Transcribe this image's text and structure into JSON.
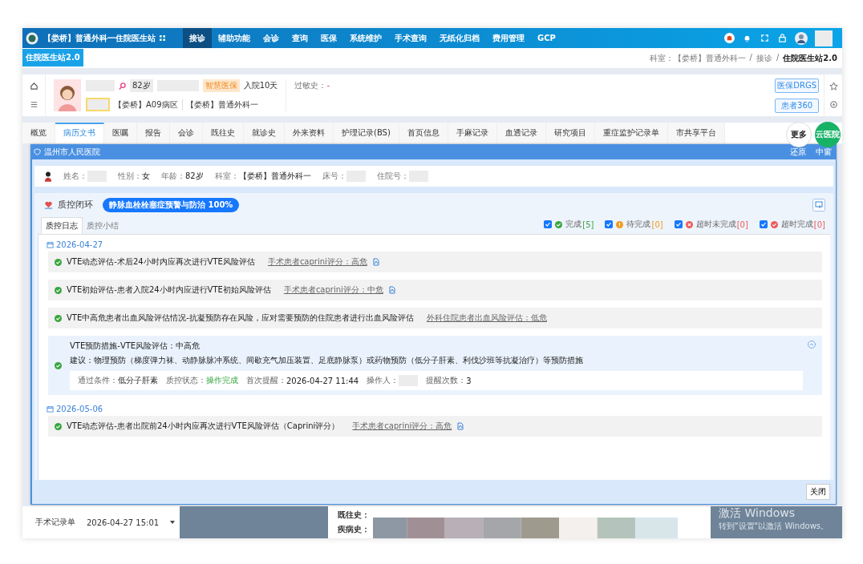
{
  "top_nav": {
    "title": "【娄桥】普通外科一住院医生站",
    "menu": [
      {
        "label": "接诊",
        "selected": true
      },
      {
        "label": "辅助功能",
        "selected": false
      },
      {
        "label": "会诊",
        "selected": false
      },
      {
        "label": "查询",
        "selected": false
      },
      {
        "label": "医保",
        "selected": false
      },
      {
        "label": "系统维护",
        "selected": false
      },
      {
        "label": "手术查询",
        "selected": false
      },
      {
        "label": "无纸化归档",
        "selected": false
      },
      {
        "label": "费用管理",
        "selected": false
      },
      {
        "label": "GCP",
        "selected": false
      }
    ]
  },
  "app_tab": "住院医生站2.0",
  "breadcrumb": [
    "科室：【娄桥】普通外科一",
    "接诊",
    "住院医生站2.0"
  ],
  "breadcrumb_separator": "/",
  "patient": {
    "age": "82岁",
    "insurance_tag": "智慧医保",
    "admission": "入院10天",
    "ward": "【娄桥】A09病区",
    "dept": "【娄桥】普通外科一",
    "allergy_label": "过敏史：",
    "allergy_value": "-",
    "buttons": [
      "医保DRGS",
      "患者360"
    ]
  },
  "record_tabs": [
    {
      "label": "概览",
      "selected": false
    },
    {
      "label": "病历文书",
      "selected": true
    },
    {
      "label": "医嘱",
      "selected": false
    },
    {
      "label": "报告",
      "selected": false
    },
    {
      "label": "会诊",
      "selected": false
    },
    {
      "label": "既往史",
      "selected": false
    },
    {
      "label": "就诊史",
      "selected": false
    },
    {
      "label": "外来资料",
      "selected": false
    },
    {
      "label": "护理记录(BS)",
      "selected": false
    },
    {
      "label": "首页信息",
      "selected": false
    },
    {
      "label": "手麻记录",
      "selected": false
    },
    {
      "label": "血透记录",
      "selected": false
    },
    {
      "label": "研究项目",
      "selected": false
    },
    {
      "label": "重症监护记录单",
      "selected": false
    },
    {
      "label": "市共享平台",
      "selected": false
    }
  ],
  "more_button": "更多",
  "cloud_button": "云医院",
  "modal": {
    "title": "温州市人民医院",
    "actions": [
      "还原",
      "中窗"
    ],
    "patient_fields": [
      {
        "label": "姓名："
      },
      {
        "label": "性别：",
        "value": "女"
      },
      {
        "label": "年龄：",
        "value": "82岁"
      },
      {
        "label": "科室：",
        "value": "【娄桥】普通外科一"
      },
      {
        "label": "床号："
      },
      {
        "label": "住院号："
      }
    ],
    "qc_title": "质控闭环",
    "qc_pill": "静脉血栓栓塞症预警与防治 100%",
    "subtabs": [
      {
        "label": "质控日志",
        "selected": true
      },
      {
        "label": "质控小结",
        "selected": false
      }
    ],
    "filters": [
      {
        "kind": "done",
        "label": "完成",
        "count": "[5]",
        "checked": true
      },
      {
        "kind": "pending",
        "label": "待完成",
        "count": "[0]",
        "checked": true
      },
      {
        "kind": "overdue",
        "label": "超时未完成",
        "count": "[0]",
        "checked": true
      },
      {
        "kind": "late",
        "label": "超时完成",
        "count": "[0]",
        "checked": true
      }
    ],
    "groups": [
      {
        "date": "2026-04-27",
        "entries": [
          {
            "kind": "simple",
            "text": "VTE动态评估-术后24小时内应再次进行VTE风险评估",
            "link": "手术患者caprini评分：高危",
            "report_icon": true
          },
          {
            "kind": "simple",
            "text": "VTE初始评估-患者入院24小时内应进行VTE初始风险评估",
            "link": "手术患者caprini评分：中危",
            "report_icon": true
          },
          {
            "kind": "simple",
            "text": "VTE中高危患者出血风险评估情况-抗凝预防存在风险，应对需要预防的住院患者进行出血风险评估",
            "link": "外科住院患者出血风险评估：低危"
          },
          {
            "kind": "detail",
            "title": "VTE预防措施-VTE风险评估：中高危",
            "advice": "建议：物理预防（梯度弹力袜、动静脉脉冲系统、间歇充气加压装置、足底静脉泵）或药物预防（低分子肝素、利伐沙班等抗凝治疗）等预防措施",
            "info": [
              {
                "label": "通过条件：",
                "value": "低分子肝素"
              },
              {
                "label": "质控状态：",
                "value": "操作完成",
                "highlight": true
              },
              {
                "label": "首次提醒：",
                "value": "2026-04-27 11:44"
              },
              {
                "label": "操作人："
              },
              {
                "label": "提醒次数：",
                "value": "3"
              }
            ]
          }
        ]
      },
      {
        "date": "2026-05-06",
        "entries": [
          {
            "kind": "simple",
            "text": "VTE动态评估-患者出院前24小时内应再次进行VTE风险评估（Caprini评分）",
            "link": "手术患者caprini评分：高危",
            "report_icon": true
          }
        ]
      }
    ],
    "close_button": "关闭"
  },
  "bottom": {
    "record_name": "手术记录单",
    "record_time": "2026-04-27 15:01",
    "history_labels": [
      "既往史：",
      "疾病史："
    ]
  },
  "os_notice": {
    "title": "激活 Windows",
    "text": "转到\"设置\"以激活 Windows。"
  }
}
